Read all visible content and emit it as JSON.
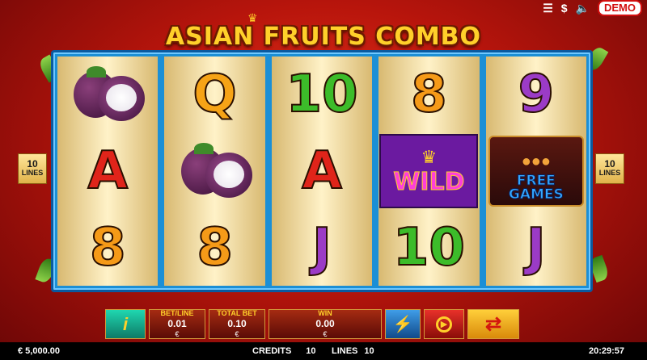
{
  "topbar": {
    "demo_label": "DEMO"
  },
  "title": "ASIAN FRUITS COMBO",
  "line_badges": {
    "left_count": "10",
    "right_count": "10",
    "label": "LINES"
  },
  "reels": [
    [
      "mangosteen",
      "A",
      "8"
    ],
    [
      "Q",
      "mangosteen",
      "8"
    ],
    [
      "10",
      "A",
      "J"
    ],
    [
      "8",
      "WILD",
      "10"
    ],
    [
      "9",
      "FREE GAMES",
      "J"
    ]
  ],
  "symbols": {
    "wild_label": "WILD",
    "free_line1": "FREE",
    "free_line2": "GAMES"
  },
  "controls": {
    "info_label": "i",
    "bet_line_label": "BET/LINE",
    "bet_line_value": "0.01",
    "bet_line_currency": "€",
    "total_bet_label": "TOTAL BET",
    "total_bet_value": "0.10",
    "total_bet_currency": "€",
    "win_label": "WIN",
    "win_value": "0.00",
    "win_currency": "€"
  },
  "status": {
    "balance": "€ 5,000.00",
    "credits_label": "CREDITS",
    "credits_value": "10",
    "lines_label": "LINES",
    "lines_value": "10",
    "time": "20:29:57"
  },
  "colors": {
    "accent": "#d30f0f",
    "frame": "#1b8fd6",
    "gold": "#ffd02a"
  }
}
